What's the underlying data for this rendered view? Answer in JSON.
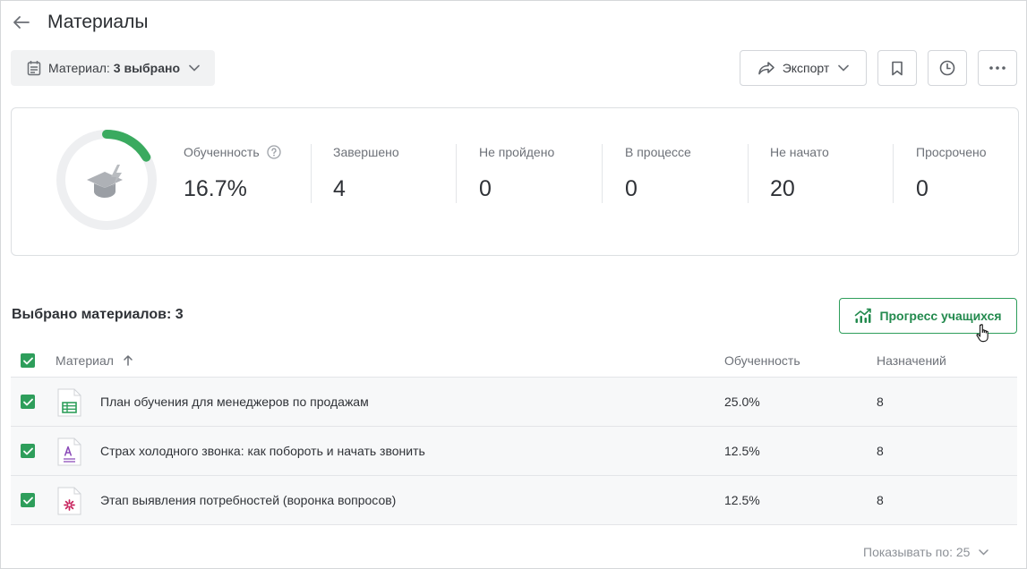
{
  "header": {
    "title": "Материалы"
  },
  "filter": {
    "label": "Материал:",
    "value": "3 выбрано"
  },
  "toolbar": {
    "export_label": "Экспорт"
  },
  "stats": {
    "progress_percent": 16.7,
    "items": [
      {
        "label": "Обученность",
        "value": "16.7%"
      },
      {
        "label": "Завершено",
        "value": "4"
      },
      {
        "label": "Не пройдено",
        "value": "0"
      },
      {
        "label": "В процессе",
        "value": "0"
      },
      {
        "label": "Не начато",
        "value": "20"
      },
      {
        "label": "Просрочено",
        "value": "0"
      }
    ]
  },
  "section": {
    "title": "Выбрано материалов: 3",
    "progress_button": "Прогресс учащихся"
  },
  "table": {
    "headers": {
      "material": "Материал",
      "progress": "Обученность",
      "assignments": "Назначений"
    },
    "rows": [
      {
        "name": "План обучения для менеджеров по продажам",
        "progress": "25.0%",
        "assignments": "8",
        "icon": "spreadsheet-file-icon"
      },
      {
        "name": "Страх холодного звонка: как побороть и начать звонить",
        "progress": "12.5%",
        "assignments": "8",
        "icon": "document-file-icon"
      },
      {
        "name": "Этап выявления потребностей (воронка вопросов)",
        "progress": "12.5%",
        "assignments": "8",
        "icon": "tool-file-icon"
      }
    ]
  },
  "pagination": {
    "page_size_label": "Показывать по: 25"
  },
  "colors": {
    "accent": "#2e9e5b",
    "text": "#2f3237",
    "muted": "#6d7178"
  }
}
